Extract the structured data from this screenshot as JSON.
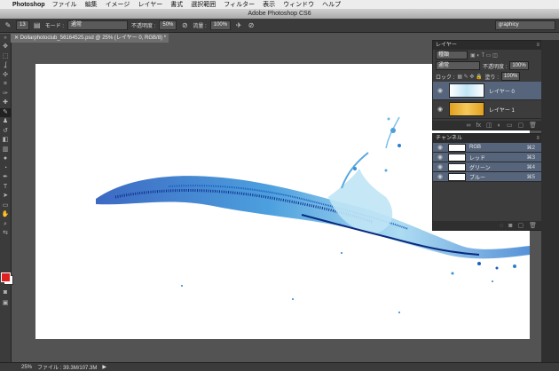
{
  "menubar": {
    "app_name": "Photoshop",
    "items": [
      "ファイル",
      "編集",
      "イメージ",
      "レイヤー",
      "書式",
      "選択範囲",
      "フィルター",
      "表示",
      "ウィンドウ",
      "ヘルプ"
    ]
  },
  "window_title": "Adobe Photoshop CS6",
  "options": {
    "brush_size": "13",
    "mode_label": "モード :",
    "mode_value": "通常",
    "opacity_label": "不透明度 :",
    "opacity_value": "50%",
    "flow_label": "流量 :",
    "flow_value": "100%",
    "workspace": "graphicy"
  },
  "document_tab": {
    "label": "Dollarphotoclub_56164525.psd @ 25% (レイヤー 0, RGB/8) *"
  },
  "layers_panel": {
    "title": "レイヤー",
    "filter_kind": "種類",
    "blend_mode": "通常",
    "opacity_label": "不透明度 :",
    "opacity_value": "100%",
    "lock_label": "ロック :",
    "fill_label": "塗り :",
    "fill_value": "100%",
    "layers": [
      {
        "name": "レイヤー 0",
        "active": true
      },
      {
        "name": "レイヤー 1",
        "active": false
      }
    ]
  },
  "channels_panel": {
    "title": "チャンネル",
    "channels": [
      {
        "name": "RGB",
        "shortcut": "⌘2"
      },
      {
        "name": "レッド",
        "shortcut": "⌘3"
      },
      {
        "name": "グリーン",
        "shortcut": "⌘4"
      },
      {
        "name": "ブルー",
        "shortcut": "⌘5"
      }
    ]
  },
  "status": {
    "zoom": "25%",
    "file_info": "ファイル : 39.3M/107.3M"
  },
  "colors": {
    "foreground": "#e02020",
    "background": "#ffffff",
    "accent_selection": "#56657c"
  }
}
